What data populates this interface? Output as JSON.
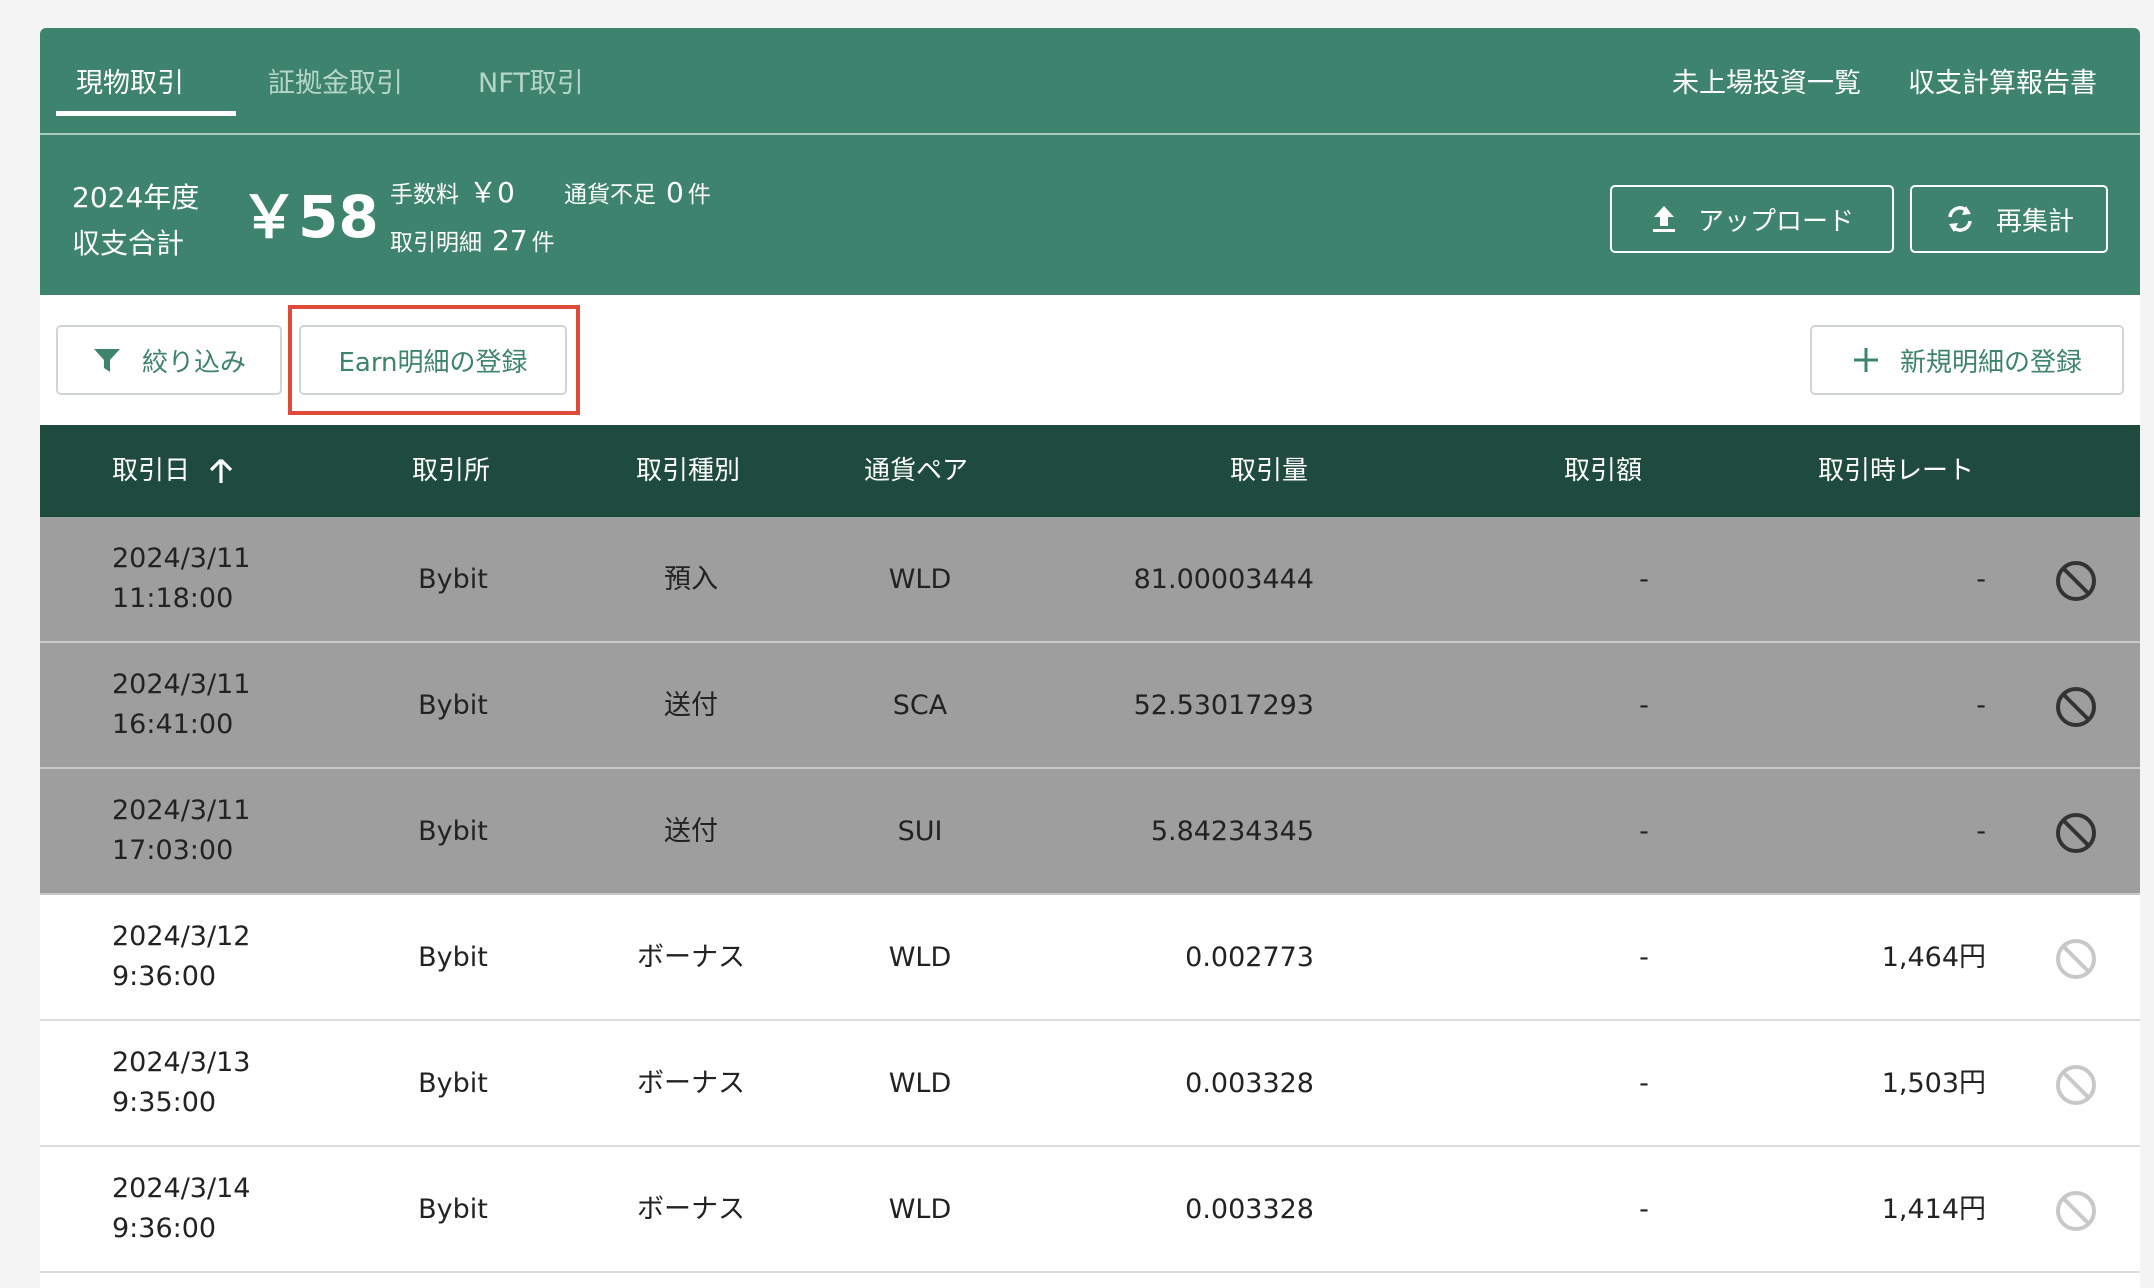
{
  "tabs": [
    {
      "label": "現物取引",
      "active": true
    },
    {
      "label": "証拠金取引",
      "active": false
    },
    {
      "label": "NFT取引",
      "active": false
    }
  ],
  "top_links": [
    "未上場投資一覧",
    "収支計算報告書"
  ],
  "summary": {
    "year_line1": "2024年度",
    "year_line2": "収支合計",
    "total": "￥58",
    "fee_label": "手数料",
    "fee_value": "￥0",
    "shortage_label": "通貨不足",
    "shortage_count": "0",
    "shortage_unit": "件",
    "details_label": "取引明細",
    "details_count": "27",
    "details_unit": "件",
    "upload_label": "アップロード",
    "recalc_label": "再集計"
  },
  "actions": {
    "filter_label": "絞り込み",
    "earn_label": "Earn明細の登録",
    "new_label": "新規明細の登録"
  },
  "table": {
    "headers": [
      "取引日",
      "取引所",
      "取引種別",
      "通貨ペア",
      "取引量",
      "取引額",
      "取引時レート"
    ],
    "sort_icon": "arrow-up-icon",
    "rows": [
      {
        "date": "2024/3/11",
        "time": "11:18:00",
        "exchange": "Bybit",
        "type": "預入",
        "pair": "WLD",
        "amount": "81.00003444",
        "value": "-",
        "rate": "-",
        "inactive": true
      },
      {
        "date": "2024/3/11",
        "time": "16:41:00",
        "exchange": "Bybit",
        "type": "送付",
        "pair": "SCA",
        "amount": "52.53017293",
        "value": "-",
        "rate": "-",
        "inactive": true
      },
      {
        "date": "2024/3/11",
        "time": "17:03:00",
        "exchange": "Bybit",
        "type": "送付",
        "pair": "SUI",
        "amount": "5.84234345",
        "value": "-",
        "rate": "-",
        "inactive": true
      },
      {
        "date": "2024/3/12",
        "time": "9:36:00",
        "exchange": "Bybit",
        "type": "ボーナス",
        "pair": "WLD",
        "amount": "0.002773",
        "value": "-",
        "rate": "1,464円",
        "inactive": false
      },
      {
        "date": "2024/3/13",
        "time": "9:35:00",
        "exchange": "Bybit",
        "type": "ボーナス",
        "pair": "WLD",
        "amount": "0.003328",
        "value": "-",
        "rate": "1,503円",
        "inactive": false
      },
      {
        "date": "2024/3/14",
        "time": "9:36:00",
        "exchange": "Bybit",
        "type": "ボーナス",
        "pair": "WLD",
        "amount": "0.003328",
        "value": "-",
        "rate": "1,414円",
        "inactive": false
      }
    ]
  },
  "colors": {
    "header_green": "#3e836d",
    "table_head": "#1f4a3e",
    "inactive_row": "#9e9e9e",
    "highlight": "#e04a3a"
  }
}
